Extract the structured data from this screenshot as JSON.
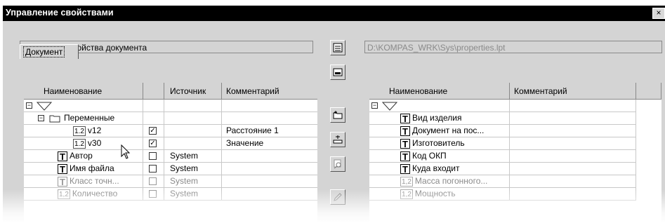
{
  "window": {
    "title": "Управление свойствами",
    "close_label": "×"
  },
  "left": {
    "header_field": "Локальные свойства документа",
    "tab_label": "Документ",
    "columns": [
      "Наименование",
      "",
      "Источник",
      "Комментарий"
    ],
    "rows": [
      {
        "name": "",
        "source": "",
        "comment": ""
      },
      {
        "name": "Переменные",
        "source": "",
        "comment": ""
      },
      {
        "name": "v12",
        "numbadge": "1.2",
        "source": "",
        "comment": "Расстояние 1",
        "checked": "☑"
      },
      {
        "name": "v30",
        "numbadge": "1.2",
        "source": "",
        "comment": "Значение",
        "checked": "☑"
      },
      {
        "name": "Автор",
        "badge": "T",
        "source": "System",
        "comment": ""
      },
      {
        "name": "Имя файла",
        "badge": "T",
        "source": "System",
        "comment": ""
      },
      {
        "name": "Класс точн...",
        "badge": "T",
        "source": "System",
        "comment": ""
      },
      {
        "name": "Количество",
        "numbadge": "1,2",
        "source": "System",
        "comment": ""
      }
    ]
  },
  "right": {
    "path_field": "D:\\KOMPAS_WRK\\Sys\\properties.lpt",
    "columns": [
      "Наименование",
      "Комментарий"
    ],
    "rows": [
      {
        "name": "",
        "comment": ""
      },
      {
        "name": "Вид изделия",
        "badge": "T",
        "comment": ""
      },
      {
        "name": "Документ на пос...",
        "badge": "T",
        "comment": ""
      },
      {
        "name": "Изготовитель",
        "badge": "T",
        "comment": ""
      },
      {
        "name": "Код ОКП",
        "badge": "T",
        "comment": ""
      },
      {
        "name": "Куда входит",
        "badge": "T",
        "comment": ""
      },
      {
        "name": "Масса погонного...",
        "numbadge": "1,2",
        "comment": ""
      },
      {
        "name": "Мощность",
        "numbadge": "1,2",
        "comment": ""
      }
    ]
  },
  "icons": {
    "left_toolbar": [
      "library-icon",
      "window-icon"
    ],
    "mid_toolbar": [
      "folder-add-icon",
      "add-row-icon",
      "search-icon",
      "edit-pencil-icon"
    ]
  }
}
